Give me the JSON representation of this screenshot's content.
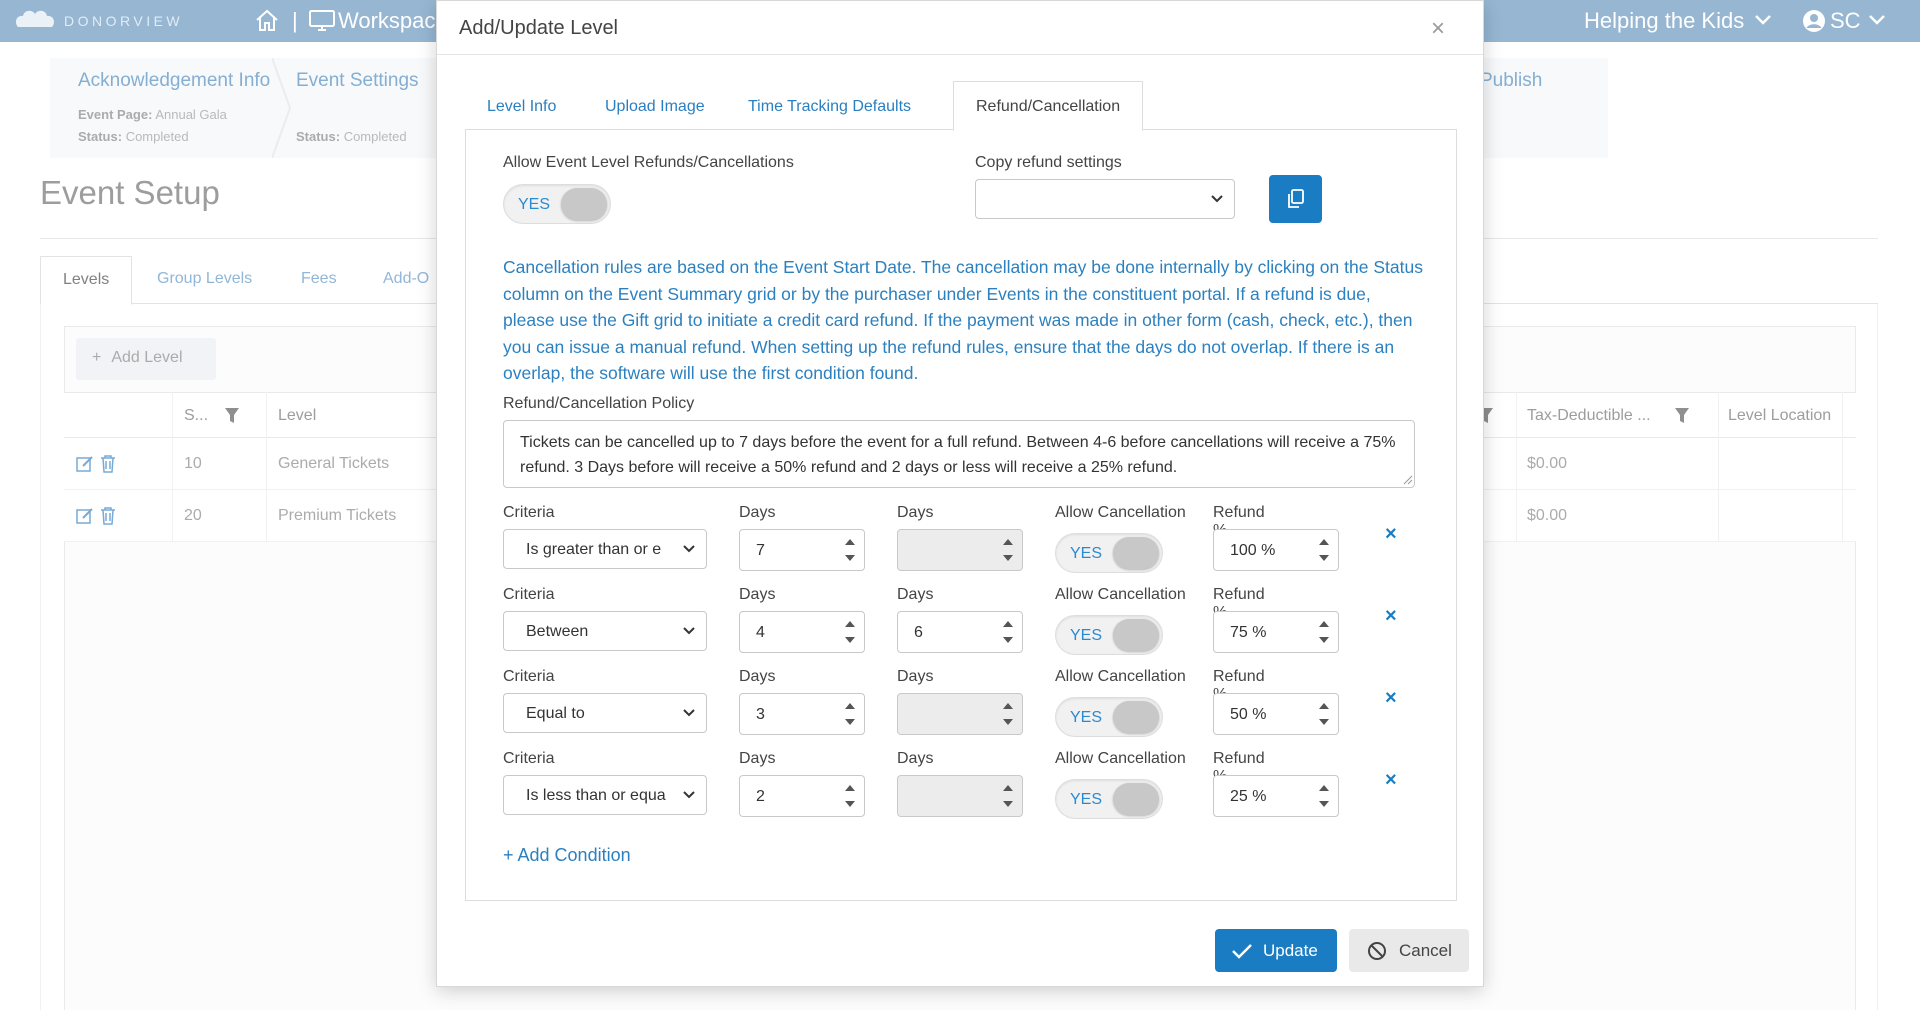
{
  "topbar": {
    "logo_text": "DONORVIEW",
    "sep": "|",
    "workspace_label": "Workspac",
    "org_name": "Helping the Kids",
    "user_initials": "SC"
  },
  "steps": [
    {
      "title": "Acknowledgement Info",
      "meta1_label": "Event Page:",
      "meta1_value": "Annual Gala",
      "meta2_label": "Status:",
      "meta2_value": "Completed"
    },
    {
      "title": "Event Settings",
      "meta2_label": "Status:",
      "meta2_value": "Completed"
    },
    {
      "title": "Publish"
    }
  ],
  "page_title": "Event Setup",
  "bg_tabs": [
    "Levels",
    "Group Levels",
    "Fees",
    "Add-O"
  ],
  "add_level_label": "Add Level",
  "grid": {
    "headers": [
      "S...",
      "Level",
      "Tax-Deductible ...",
      "Level Location"
    ],
    "rows": [
      {
        "seq": "10",
        "level": "General Tickets",
        "tax": "$0.00"
      },
      {
        "seq": "20",
        "level": "Premium Tickets",
        "tax": "$0.00"
      }
    ]
  },
  "modal": {
    "title": "Add/Update Level",
    "close": "×",
    "tabs": [
      "Level Info",
      "Upload Image",
      "Time Tracking Defaults",
      "Refund/Cancellation"
    ],
    "allow_refunds_label": "Allow Event Level Refunds/Cancellations",
    "allow_refunds_value": "YES",
    "copy_label": "Copy refund settings",
    "copy_value": "",
    "info_text": "Cancellation rules are based on the Event Start Date. The cancellation may be done internally by clicking on the Status column on the Event Summary grid or by the purchaser under Events in the constituent portal. If a refund is due, please use the Gift grid to initiate a credit card refund. If the payment was made in other form (cash, check, etc.), then you can issue a manual refund. When setting up the refund rules, ensure that the days do not overlap. If there is an overlap, the software will use the first condition found.",
    "policy_label": "Refund/Cancellation Policy",
    "policy_text": "Tickets can be cancelled up to 7 days before the event for a full refund. Between 4-6 before cancellations will receive a 75% refund. 3 Days before will receive a 50% refund and 2 days or less will receive a 25% refund.",
    "field_labels": {
      "criteria": "Criteria",
      "days": "Days",
      "allow_cancellation": "Allow Cancellation",
      "refund": "Refund %"
    },
    "conditions": [
      {
        "criteria": "Is greater than or e",
        "days1": "7",
        "days2": "",
        "allow": "YES",
        "refund": "100 %"
      },
      {
        "criteria": "Between",
        "days1": "4",
        "days2": "6",
        "allow": "YES",
        "refund": "75 %"
      },
      {
        "criteria": "Equal to",
        "days1": "3",
        "days2": "",
        "allow": "YES",
        "refund": "50 %"
      },
      {
        "criteria": "Is less than or equa",
        "days1": "2",
        "days2": "",
        "allow": "YES",
        "refund": "25 %"
      }
    ],
    "remove_symbol": "×",
    "add_condition": "+ Add Condition",
    "update_label": "Update",
    "cancel_label": "Cancel"
  },
  "colors": {
    "topbar": "#7fa6c9",
    "accent": "#1a7cc2",
    "info_text": "#2b80bf"
  }
}
